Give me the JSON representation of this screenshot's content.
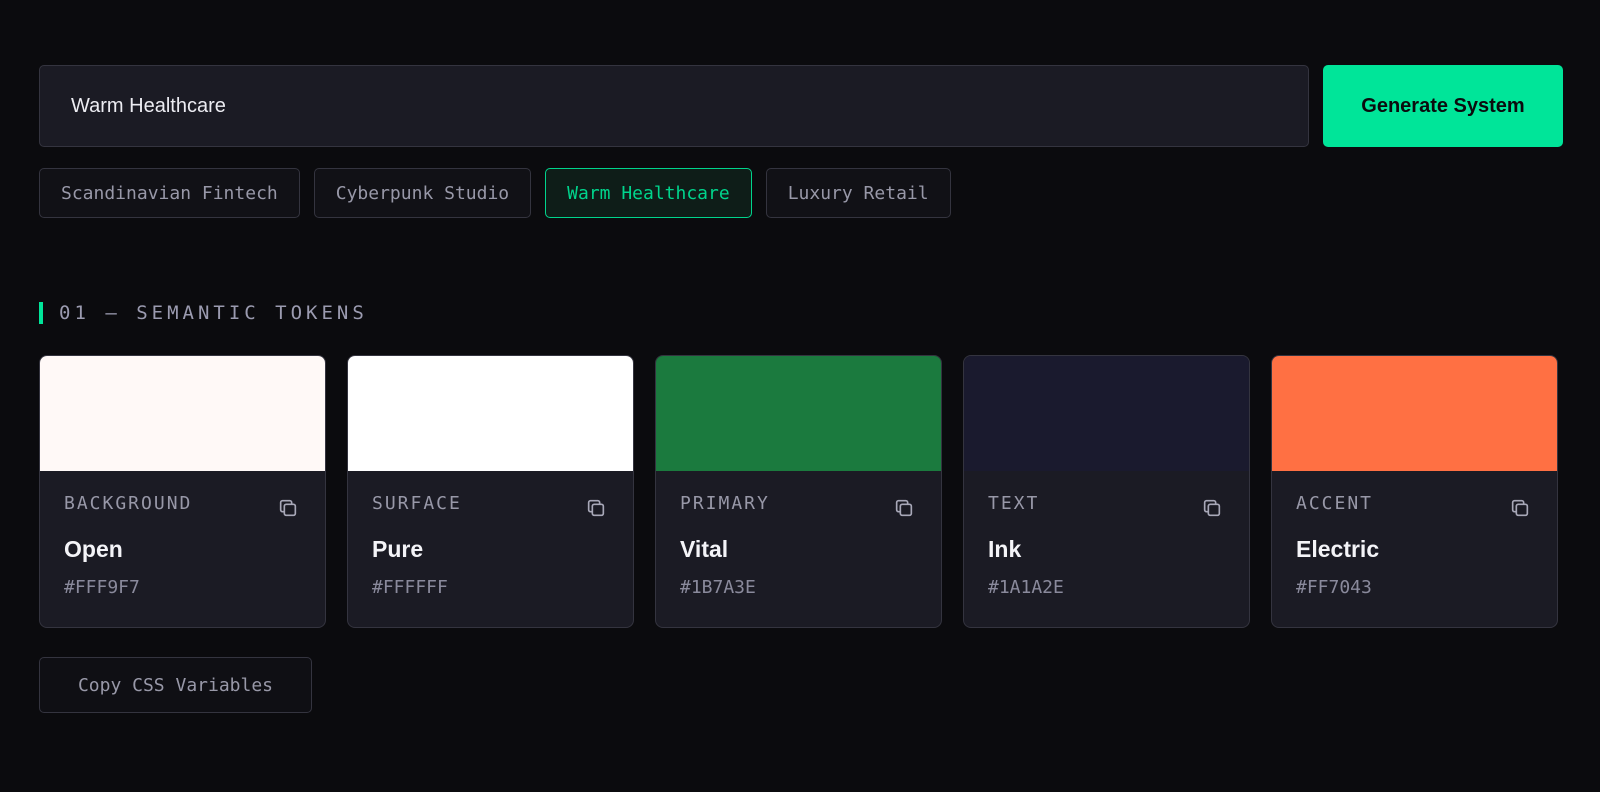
{
  "search": {
    "value": "Warm Healthcare",
    "generate_label": "Generate System"
  },
  "presets": [
    {
      "label": "Scandinavian Fintech",
      "active": false
    },
    {
      "label": "Cyberpunk Studio",
      "active": false
    },
    {
      "label": "Warm Healthcare",
      "active": true
    },
    {
      "label": "Luxury Retail",
      "active": false
    }
  ],
  "section": {
    "title": "01 — SEMANTIC TOKENS"
  },
  "tokens": [
    {
      "role": "BACKGROUND",
      "name": "Open",
      "hex": "#FFF9F7",
      "swatch": "#FFF9F7",
      "icon": "copy-icon"
    },
    {
      "role": "SURFACE",
      "name": "Pure",
      "hex": "#FFFFFF",
      "swatch": "#FFFFFF",
      "icon": "copy-icon"
    },
    {
      "role": "PRIMARY",
      "name": "Vital",
      "hex": "#1B7A3E",
      "swatch": "#1B7A3E",
      "icon": "copy-icon"
    },
    {
      "role": "TEXT",
      "name": "Ink",
      "hex": "#1A1A2E",
      "swatch": "#1A1A2E",
      "icon": "copy-icon"
    },
    {
      "role": "ACCENT",
      "name": "Electric",
      "hex": "#FF7043",
      "swatch": "#FF7043",
      "icon": "copy-icon"
    }
  ],
  "actions": {
    "copy_css_label": "Copy CSS Variables"
  },
  "colors": {
    "accent": "#00E599",
    "background": "#0B0B0E",
    "panel": "#1B1B24",
    "border": "#34343F"
  }
}
